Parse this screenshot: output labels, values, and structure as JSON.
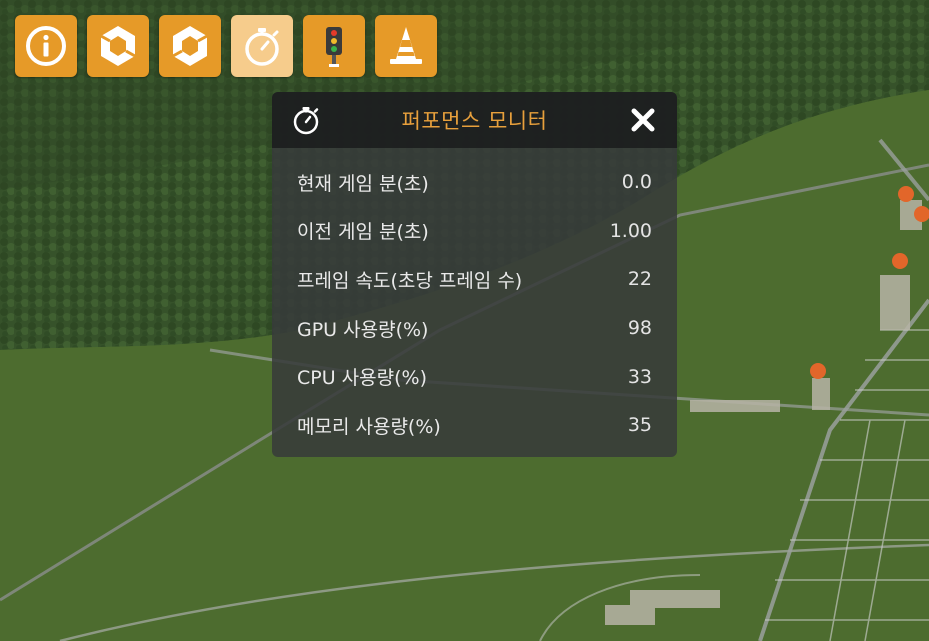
{
  "toolbar": {
    "buttons": [
      {
        "icon": "info-icon",
        "active": false
      },
      {
        "icon": "hexagon-ring-icon",
        "active": false
      },
      {
        "icon": "hexagon-ring-alt-icon",
        "active": false
      },
      {
        "icon": "stopwatch-icon",
        "active": true
      },
      {
        "icon": "traffic-light-icon",
        "active": false
      },
      {
        "icon": "traffic-cone-icon",
        "active": false
      }
    ]
  },
  "panel": {
    "title": "퍼포먼스 모니터",
    "header_icon": "stopwatch-icon",
    "close_icon": "close-icon",
    "rows": [
      {
        "label": "현재 게임 분(초)",
        "value": "0.0"
      },
      {
        "label": "이전 게임 분(초)",
        "value": "1.00"
      },
      {
        "label": "프레임 속도(초당 프레임 수)",
        "value": "22"
      },
      {
        "label": "GPU 사용량(%)",
        "value": "98"
      },
      {
        "label": "CPU 사용량(%)",
        "value": "33"
      },
      {
        "label": "메모리 사용량(%)",
        "value": "35"
      }
    ]
  },
  "colors": {
    "accent": "#e69a28",
    "accent_active": "#f6cc8c",
    "title": "#e8a03c",
    "panel_bg": "#373a3a",
    "header_bg": "#1c1e1e"
  }
}
